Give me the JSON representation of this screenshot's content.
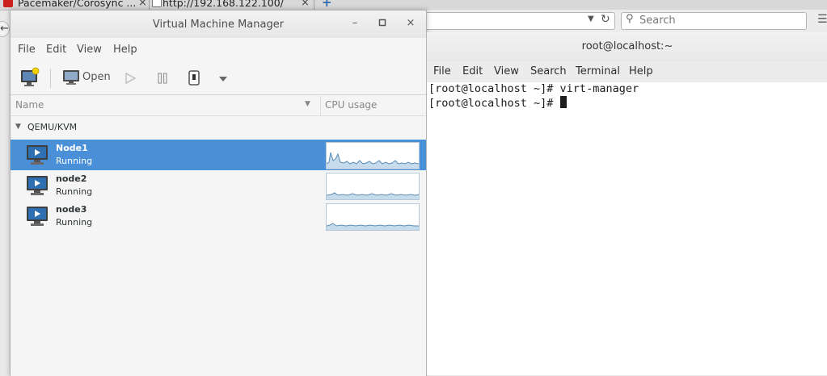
{
  "browser": {
    "tab1_title": "Pacemaker/Corosync ...",
    "tab1_close": "×",
    "tab2_title": "http://192.168.122.100/",
    "tab2_close": "×",
    "search_placeholder": "Search"
  },
  "vmm": {
    "title": "Virtual Machine Manager",
    "window_buttons": {
      "minimize": "–",
      "maximize": "▫",
      "close": "×"
    },
    "menu": [
      "File",
      "Edit",
      "View",
      "Help"
    ],
    "toolbar": {
      "open_label": "Open"
    },
    "columns": {
      "name": "Name",
      "cpu": "CPU usage"
    },
    "group": "QEMU/KVM",
    "vms": [
      {
        "name": "Node1",
        "status": "Running",
        "selected": true
      },
      {
        "name": "node2",
        "status": "Running",
        "selected": false
      },
      {
        "name": "node3",
        "status": "Running",
        "selected": false
      }
    ]
  },
  "terminal": {
    "title": "root@localhost:~",
    "menu": [
      "File",
      "Edit",
      "View",
      "Search",
      "Terminal",
      "Help"
    ],
    "lines": [
      "[root@localhost ~]# virt-manager",
      "[root@localhost ~]# "
    ]
  },
  "colors": {
    "selection": "#4a90d9",
    "graph_line": "#5a8bb5",
    "graph_fill": "#c6dbec"
  }
}
